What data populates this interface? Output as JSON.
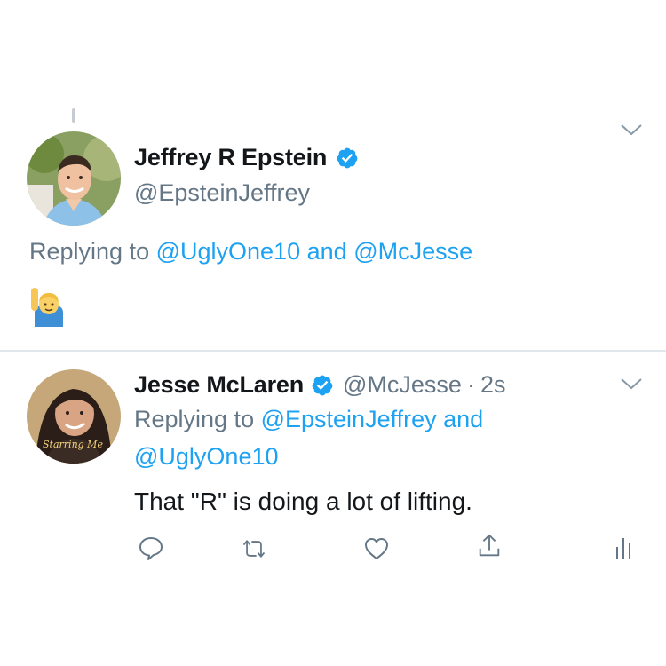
{
  "tweet1": {
    "author_name": "Jeffrey R Epstein",
    "author_handle": "@EpsteinJeffrey",
    "verified": true,
    "replying_prefix": "Replying to",
    "reply_user1": "@UglyOne10",
    "reply_and": "and",
    "reply_user2": "@McJesse",
    "emoji_icon": "person-raising-hand-emoji"
  },
  "tweet2": {
    "author_name": "Jesse McLaren",
    "author_handle": "@McJesse",
    "time_sep": "·",
    "time": "2s",
    "verified": true,
    "replying_prefix": "Replying to",
    "reply_user1": "@EpsteinJeffrey",
    "reply_and": "and",
    "reply_user2": "@UglyOne10",
    "body": "That \"R\" is doing a lot of lifting.",
    "avatar_overlay": "Starring Me",
    "actions": [
      "reply-icon",
      "retweet-icon",
      "like-icon",
      "share-icon",
      "analytics-icon"
    ]
  },
  "colors": {
    "link_blue": "#1da1f2",
    "text": "#14171a",
    "muted": "#657786",
    "divider": "#e1e8ed",
    "icon_grey": "#657786"
  }
}
